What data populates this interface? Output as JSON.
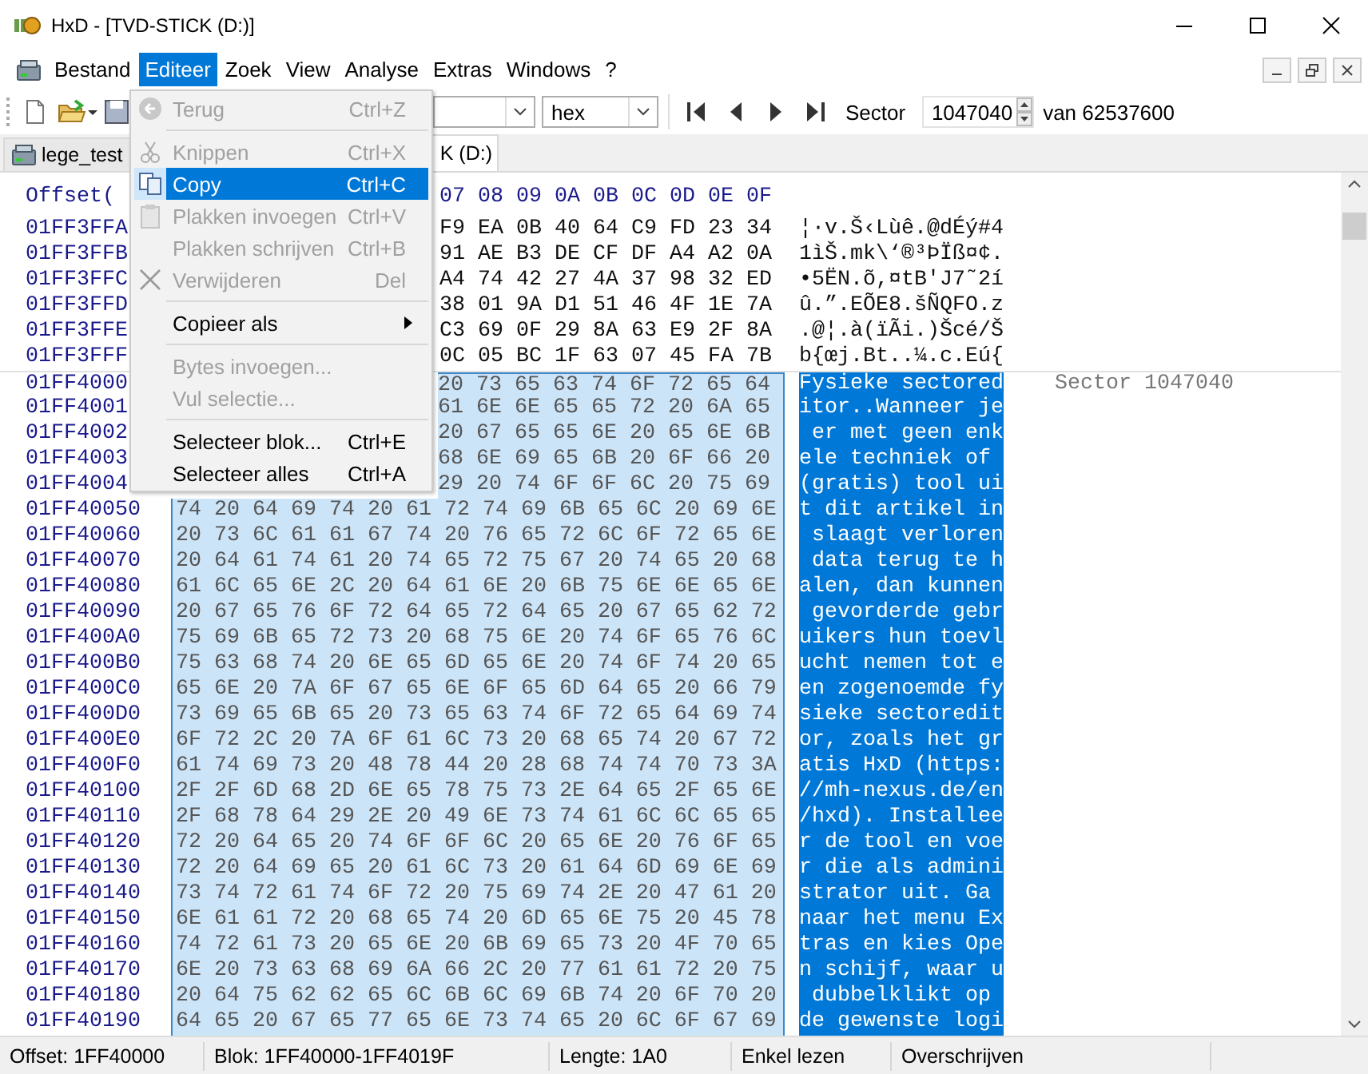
{
  "window": {
    "title": "HxD - [TVD-STICK (D:)]"
  },
  "menu_bar": [
    {
      "label": "Bestand",
      "selected": false
    },
    {
      "label": "Editeer",
      "selected": true
    },
    {
      "label": "Zoek",
      "selected": false
    },
    {
      "label": "View",
      "selected": false
    },
    {
      "label": "Analyse",
      "selected": false
    },
    {
      "label": "Extras",
      "selected": false
    },
    {
      "label": "Windows",
      "selected": false
    },
    {
      "label": "?",
      "selected": false
    }
  ],
  "toolbar": {
    "data_type": "hex",
    "sector_label": "Sector",
    "sector_value": "1047040",
    "sector_total": "van 62537600"
  },
  "tabs": [
    {
      "label": "lege_test",
      "selected": false
    },
    {
      "label": "K (D:)",
      "selected": true
    }
  ],
  "editor": {
    "offset_header": "Offset(",
    "column_headers": [
      "07",
      "08",
      "09",
      "0A",
      "0B",
      "0C",
      "0D",
      "0E",
      "0F"
    ],
    "rows": [
      {
        "offset": "01FF3FFA",
        "bytes": [
          "F9",
          "EA",
          "0B",
          "40",
          "64",
          "C9",
          "FD",
          "23",
          "34"
        ],
        "text": "¦·v.Š‹Lùê.@dÉý#4",
        "selected": false
      },
      {
        "offset": "01FF3FFB",
        "bytes": [
          "91",
          "AE",
          "B3",
          "DE",
          "CF",
          "DF",
          "A4",
          "A2",
          "0A"
        ],
        "text": "1ìŠ.mk\\‘®³ÞÏß¤¢.",
        "selected": false
      },
      {
        "offset": "01FF3FFC",
        "bytes": [
          "A4",
          "74",
          "42",
          "27",
          "4A",
          "37",
          "98",
          "32",
          "ED"
        ],
        "text": "•5ËN.õ,¤tB'J7˜2í",
        "selected": false
      },
      {
        "offset": "01FF3FFD",
        "bytes": [
          "38",
          "01",
          "9A",
          "D1",
          "51",
          "46",
          "4F",
          "1E",
          "7A"
        ],
        "text": "û.”.EÕE8.šÑQFO.z",
        "selected": false
      },
      {
        "offset": "01FF3FFE",
        "bytes": [
          "C3",
          "69",
          "0F",
          "29",
          "8A",
          "63",
          "E9",
          "2F",
          "8A"
        ],
        "text": ".@¦.à(ïÃi.)Šcé/Š",
        "selected": false
      },
      {
        "offset": "01FF3FFF",
        "bytes": [
          "0C",
          "05",
          "BC",
          "1F",
          "63",
          "07",
          "45",
          "FA",
          "7B"
        ],
        "text": "b{œj.Bt..¼.c.Eú{",
        "selected": false
      },
      {
        "offset": "01FF4000",
        "bytes": [
          "20",
          "73",
          "65",
          "63",
          "74",
          "6F",
          "72",
          "65",
          "64"
        ],
        "text": "Fysieke sectored",
        "selected": true,
        "sector_label": "Sector 1047040"
      },
      {
        "offset": "01FF4001",
        "bytes": [
          "61",
          "6E",
          "6E",
          "65",
          "65",
          "72",
          "20",
          "6A",
          "65"
        ],
        "text": "itor..Wanneer je",
        "selected": true
      },
      {
        "offset": "01FF4002",
        "bytes": [
          "20",
          "67",
          "65",
          "65",
          "6E",
          "20",
          "65",
          "6E",
          "6B"
        ],
        "text": " er met geen enk",
        "selected": true
      },
      {
        "offset": "01FF4003",
        "bytes": [
          "68",
          "6E",
          "69",
          "65",
          "6B",
          "20",
          "6F",
          "66",
          "20"
        ],
        "text": "ele techniek of ",
        "selected": true
      },
      {
        "offset": "01FF4004",
        "bytes": [
          "29",
          "20",
          "74",
          "6F",
          "6F",
          "6C",
          "20",
          "75",
          "69"
        ],
        "text": "(gratis) tool ui",
        "selected": true
      },
      {
        "offset": "01FF40050",
        "bytes": [
          "74",
          "20",
          "64",
          "69",
          "74",
          "20",
          "61",
          "72",
          "74",
          "69",
          "6B",
          "65",
          "6C",
          "20",
          "69",
          "6E"
        ],
        "text": "t dit artikel in",
        "selected": true
      },
      {
        "offset": "01FF40060",
        "bytes": [
          "20",
          "73",
          "6C",
          "61",
          "61",
          "67",
          "74",
          "20",
          "76",
          "65",
          "72",
          "6C",
          "6F",
          "72",
          "65",
          "6E"
        ],
        "text": " slaagt verloren",
        "selected": true
      },
      {
        "offset": "01FF40070",
        "bytes": [
          "20",
          "64",
          "61",
          "74",
          "61",
          "20",
          "74",
          "65",
          "72",
          "75",
          "67",
          "20",
          "74",
          "65",
          "20",
          "68"
        ],
        "text": " data terug te h",
        "selected": true
      },
      {
        "offset": "01FF40080",
        "bytes": [
          "61",
          "6C",
          "65",
          "6E",
          "2C",
          "20",
          "64",
          "61",
          "6E",
          "20",
          "6B",
          "75",
          "6E",
          "6E",
          "65",
          "6E"
        ],
        "text": "alen, dan kunnen",
        "selected": true
      },
      {
        "offset": "01FF40090",
        "bytes": [
          "20",
          "67",
          "65",
          "76",
          "6F",
          "72",
          "64",
          "65",
          "72",
          "64",
          "65",
          "20",
          "67",
          "65",
          "62",
          "72"
        ],
        "text": " gevorderde gebr",
        "selected": true
      },
      {
        "offset": "01FF400A0",
        "bytes": [
          "75",
          "69",
          "6B",
          "65",
          "72",
          "73",
          "20",
          "68",
          "75",
          "6E",
          "20",
          "74",
          "6F",
          "65",
          "76",
          "6C"
        ],
        "text": "uikers hun toevl",
        "selected": true
      },
      {
        "offset": "01FF400B0",
        "bytes": [
          "75",
          "63",
          "68",
          "74",
          "20",
          "6E",
          "65",
          "6D",
          "65",
          "6E",
          "20",
          "74",
          "6F",
          "74",
          "20",
          "65"
        ],
        "text": "ucht nemen tot e",
        "selected": true
      },
      {
        "offset": "01FF400C0",
        "bytes": [
          "65",
          "6E",
          "20",
          "7A",
          "6F",
          "67",
          "65",
          "6E",
          "6F",
          "65",
          "6D",
          "64",
          "65",
          "20",
          "66",
          "79"
        ],
        "text": "en zogenoemde fy",
        "selected": true
      },
      {
        "offset": "01FF400D0",
        "bytes": [
          "73",
          "69",
          "65",
          "6B",
          "65",
          "20",
          "73",
          "65",
          "63",
          "74",
          "6F",
          "72",
          "65",
          "64",
          "69",
          "74"
        ],
        "text": "sieke sectoredit",
        "selected": true
      },
      {
        "offset": "01FF400E0",
        "bytes": [
          "6F",
          "72",
          "2C",
          "20",
          "7A",
          "6F",
          "61",
          "6C",
          "73",
          "20",
          "68",
          "65",
          "74",
          "20",
          "67",
          "72"
        ],
        "text": "or, zoals het gr",
        "selected": true
      },
      {
        "offset": "01FF400F0",
        "bytes": [
          "61",
          "74",
          "69",
          "73",
          "20",
          "48",
          "78",
          "44",
          "20",
          "28",
          "68",
          "74",
          "74",
          "70",
          "73",
          "3A"
        ],
        "text": "atis HxD (https:",
        "selected": true
      },
      {
        "offset": "01FF40100",
        "bytes": [
          "2F",
          "2F",
          "6D",
          "68",
          "2D",
          "6E",
          "65",
          "78",
          "75",
          "73",
          "2E",
          "64",
          "65",
          "2F",
          "65",
          "6E"
        ],
        "text": "//mh-nexus.de/en",
        "selected": true
      },
      {
        "offset": "01FF40110",
        "bytes": [
          "2F",
          "68",
          "78",
          "64",
          "29",
          "2E",
          "20",
          "49",
          "6E",
          "73",
          "74",
          "61",
          "6C",
          "6C",
          "65",
          "65"
        ],
        "text": "/hxd). Installee",
        "selected": true
      },
      {
        "offset": "01FF40120",
        "bytes": [
          "72",
          "20",
          "64",
          "65",
          "20",
          "74",
          "6F",
          "6F",
          "6C",
          "20",
          "65",
          "6E",
          "20",
          "76",
          "6F",
          "65"
        ],
        "text": "r de tool en voe",
        "selected": true
      },
      {
        "offset": "01FF40130",
        "bytes": [
          "72",
          "20",
          "64",
          "69",
          "65",
          "20",
          "61",
          "6C",
          "73",
          "20",
          "61",
          "64",
          "6D",
          "69",
          "6E",
          "69"
        ],
        "text": "r die als admini",
        "selected": true
      },
      {
        "offset": "01FF40140",
        "bytes": [
          "73",
          "74",
          "72",
          "61",
          "74",
          "6F",
          "72",
          "20",
          "75",
          "69",
          "74",
          "2E",
          "20",
          "47",
          "61",
          "20"
        ],
        "text": "strator uit. Ga ",
        "selected": true
      },
      {
        "offset": "01FF40150",
        "bytes": [
          "6E",
          "61",
          "61",
          "72",
          "20",
          "68",
          "65",
          "74",
          "20",
          "6D",
          "65",
          "6E",
          "75",
          "20",
          "45",
          "78"
        ],
        "text": "naar het menu Ex",
        "selected": true
      },
      {
        "offset": "01FF40160",
        "bytes": [
          "74",
          "72",
          "61",
          "73",
          "20",
          "65",
          "6E",
          "20",
          "6B",
          "69",
          "65",
          "73",
          "20",
          "4F",
          "70",
          "65"
        ],
        "text": "tras en kies Ope",
        "selected": true
      },
      {
        "offset": "01FF40170",
        "bytes": [
          "6E",
          "20",
          "73",
          "63",
          "68",
          "69",
          "6A",
          "66",
          "2C",
          "20",
          "77",
          "61",
          "61",
          "72",
          "20",
          "75"
        ],
        "text": "n schijf, waar u",
        "selected": true
      },
      {
        "offset": "01FF40180",
        "bytes": [
          "20",
          "64",
          "75",
          "62",
          "62",
          "65",
          "6C",
          "6B",
          "6C",
          "69",
          "6B",
          "74",
          "20",
          "6F",
          "70",
          "20"
        ],
        "text": " dubbelklikt op ",
        "selected": true
      },
      {
        "offset": "01FF40190",
        "bytes": [
          "64",
          "65",
          "20",
          "67",
          "65",
          "77",
          "65",
          "6E",
          "73",
          "74",
          "65",
          "20",
          "6C",
          "6F",
          "67",
          "69"
        ],
        "text": "de gewenste logi",
        "selected": true
      }
    ]
  },
  "edit_menu": {
    "items": [
      {
        "kind": "item",
        "label": "Terug",
        "shortcut": "Ctrl+Z",
        "disabled": true,
        "selected": false
      },
      {
        "kind": "separator"
      },
      {
        "kind": "item",
        "label": "Knippen",
        "shortcut": "Ctrl+X",
        "disabled": true,
        "selected": false
      },
      {
        "kind": "item",
        "label": "Copy",
        "shortcut": "Ctrl+C",
        "disabled": false,
        "selected": true
      },
      {
        "kind": "item",
        "label": "Plakken invoegen",
        "shortcut": "Ctrl+V",
        "disabled": true,
        "selected": false
      },
      {
        "kind": "item",
        "label": "Plakken schrijven",
        "shortcut": "Ctrl+B",
        "disabled": true,
        "selected": false
      },
      {
        "kind": "item",
        "label": "Verwijderen",
        "shortcut": "Del",
        "disabled": true,
        "selected": false
      },
      {
        "kind": "separator"
      },
      {
        "kind": "submenu",
        "label": "Copieer als",
        "disabled": false,
        "selected": false
      },
      {
        "kind": "separator"
      },
      {
        "kind": "item",
        "label": "Bytes invoegen...",
        "disabled": true,
        "selected": false
      },
      {
        "kind": "item",
        "label": "Vul selectie...",
        "disabled": true,
        "selected": false
      },
      {
        "kind": "separator"
      },
      {
        "kind": "item",
        "label": "Selecteer blok...",
        "shortcut": "Ctrl+E",
        "disabled": false,
        "selected": false
      },
      {
        "kind": "item",
        "label": "Selecteer alles",
        "shortcut": "Ctrl+A",
        "disabled": false,
        "selected": false
      }
    ]
  },
  "status_bar": [
    "Offset: 1FF40000",
    "Blok: 1FF40000-1FF4019F",
    "Lengte: 1A0",
    "Enkel lezen",
    "Overschrijven"
  ]
}
